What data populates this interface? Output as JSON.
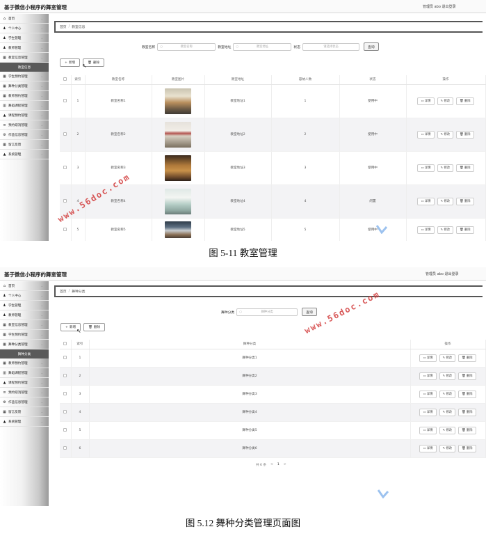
{
  "shot1": {
    "app_title": "基于微信小程序的舞室管理",
    "user_info": "管理员 abo   退出登录",
    "sidebar": {
      "top_items": [
        {
          "icon": "home-icon",
          "label": "首页"
        },
        {
          "icon": "user-icon",
          "label": "个人中心"
        },
        {
          "icon": "user-icon",
          "label": "学生管理"
        },
        {
          "icon": "user-icon",
          "label": "教师管理"
        },
        {
          "icon": "grid-icon",
          "label": "教室信息管理"
        }
      ],
      "section_label": "教室信息",
      "bottom_items": [
        {
          "icon": "grid-icon",
          "label": "学生预约管理"
        },
        {
          "icon": "grid-icon",
          "label": "舞种分类管理"
        },
        {
          "icon": "grid-icon",
          "label": "教师预约管理"
        },
        {
          "icon": "chart-icon",
          "label": "舞蹈课程管理"
        },
        {
          "icon": "bag-icon",
          "label": "课程预约管理"
        },
        {
          "icon": "list-icon",
          "label": "预约取消管理"
        },
        {
          "icon": "gear-icon",
          "label": "作品信息管理"
        },
        {
          "icon": "grid-icon",
          "label": "留言反馈"
        },
        {
          "icon": "bag-icon",
          "label": "系统管理"
        }
      ]
    },
    "breadcrumb": {
      "home": "首页",
      "current": "教室信息"
    },
    "filters": {
      "name_label": "教室名称",
      "name_placeholder": "教室名称",
      "addr_label": "教室地址",
      "addr_placeholder": "教室地址",
      "status_label": "状态",
      "status_placeholder": "请选择状态",
      "search_button": "查询"
    },
    "actions": {
      "add": "新增",
      "delete": "删除"
    },
    "table": {
      "headers": [
        "",
        "索引",
        "教室名称",
        "教室图片",
        "教室地址",
        "容纳人数",
        "状态",
        "操作"
      ],
      "rows": [
        {
          "idx": "1",
          "name": "教室名称1",
          "addr": "教室地址1",
          "cap": "1",
          "status": "使用中"
        },
        {
          "idx": "2",
          "name": "教室名称2",
          "addr": "教室地址2",
          "cap": "2",
          "status": "使用中"
        },
        {
          "idx": "3",
          "name": "教室名称3",
          "addr": "教室地址3",
          "cap": "3",
          "status": "使用中"
        },
        {
          "idx": "4",
          "name": "教室名称4",
          "addr": "教室地址4",
          "cap": "4",
          "status": "闲置"
        },
        {
          "idx": "5",
          "name": "教室名称5",
          "addr": "教室地址5",
          "cap": "5",
          "status": "使用中"
        }
      ],
      "row_buttons": {
        "detail": "详情",
        "edit": "修改",
        "remove": "删除"
      }
    }
  },
  "caption1": "图 5-11 教室管理",
  "shot2": {
    "app_title": "基于微信小程序的舞室管理",
    "user_info": "管理员 abo   退出登录",
    "sidebar": {
      "top_items": [
        {
          "icon": "home-icon",
          "label": "首页"
        },
        {
          "icon": "user-icon",
          "label": "个人中心"
        },
        {
          "icon": "user-icon",
          "label": "学生管理"
        },
        {
          "icon": "user-icon",
          "label": "教师管理"
        },
        {
          "icon": "grid-icon",
          "label": "教室信息管理"
        },
        {
          "icon": "grid-icon",
          "label": "学生预约管理"
        },
        {
          "icon": "grid-icon",
          "label": "舞种分类管理"
        }
      ],
      "section_label": "舞种分类",
      "bottom_items": [
        {
          "icon": "grid-icon",
          "label": "教师预约管理"
        },
        {
          "icon": "chart-icon",
          "label": "舞蹈课程管理"
        },
        {
          "icon": "bag-icon",
          "label": "课程预约管理"
        },
        {
          "icon": "list-icon",
          "label": "预约取消管理"
        },
        {
          "icon": "gear-icon",
          "label": "作品信息管理"
        },
        {
          "icon": "grid-icon",
          "label": "留言反馈"
        },
        {
          "icon": "bag-icon",
          "label": "系统管理"
        }
      ]
    },
    "breadcrumb": {
      "home": "首页",
      "current": "舞种分类"
    },
    "filters": {
      "label": "舞种分类",
      "placeholder": "舞种分类",
      "search_button": "查询"
    },
    "actions": {
      "add": "新增",
      "delete": "删除"
    },
    "table": {
      "headers": [
        "",
        "索引",
        "舞种分类",
        "操作"
      ],
      "rows": [
        {
          "idx": "1",
          "name": "舞种分类1"
        },
        {
          "idx": "2",
          "name": "舞种分类2"
        },
        {
          "idx": "3",
          "name": "舞种分类3"
        },
        {
          "idx": "4",
          "name": "舞种分类4"
        },
        {
          "idx": "5",
          "name": "舞种分类5"
        },
        {
          "idx": "6",
          "name": "舞种分类6"
        }
      ],
      "row_buttons": {
        "detail": "详情",
        "edit": "修改",
        "remove": "删除"
      }
    },
    "pager": {
      "total": "共 6 条",
      "prev": "<",
      "page": "1",
      "next": ">"
    }
  },
  "caption2": "图 5.12 舞种分类管理页面图",
  "watermark": "www.56doc.com",
  "colors": {
    "watermark": "#d23a3a",
    "logo": "#4a90e2",
    "sidebar_section": "#5a5a5a",
    "row_alt": "#f3f3f5"
  }
}
